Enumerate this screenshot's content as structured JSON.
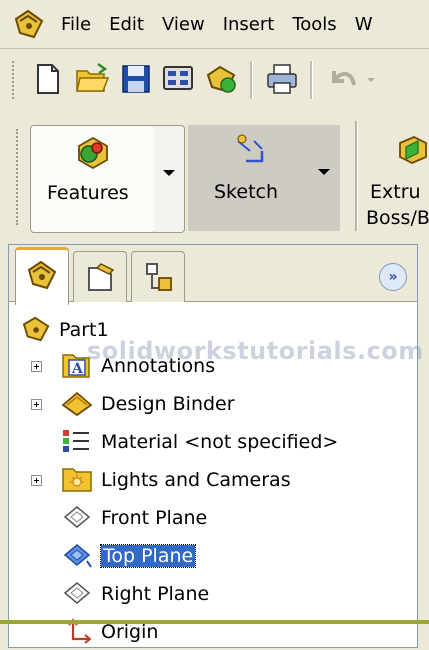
{
  "menu": {
    "items": [
      {
        "label": "File"
      },
      {
        "label": "Edit"
      },
      {
        "label": "View"
      },
      {
        "label": "Insert"
      },
      {
        "label": "Tools"
      },
      {
        "label": "W"
      }
    ]
  },
  "toolbar": {
    "buttons": [
      "new-document-icon",
      "open-folder-icon",
      "save-icon",
      "options-icon",
      "rebuild-icon",
      "print-icon",
      "undo-icon"
    ]
  },
  "command_manager": {
    "features_label": "Features",
    "sketch_label": "Sketch",
    "extrude_label_line1": "Extru",
    "extrude_label_line2": "Boss/B"
  },
  "feature_manager": {
    "root": "Part1",
    "watermark": "solidworkstutorials.com",
    "expand_glyph": "»",
    "items": [
      {
        "label": "Annotations",
        "expandable": true
      },
      {
        "label": "Design Binder",
        "expandable": true
      },
      {
        "label": "Material <not specified>",
        "expandable": false
      },
      {
        "label": "Lights and Cameras",
        "expandable": true
      },
      {
        "label": "Front Plane",
        "expandable": false
      },
      {
        "label": "Top Plane",
        "expandable": false,
        "selected": true
      },
      {
        "label": "Right Plane",
        "expandable": false
      },
      {
        "label": "Origin",
        "expandable": false
      }
    ]
  },
  "colors": {
    "chrome": "#ece9d8",
    "selection": "#316ac5",
    "accent_line": "#9aa832"
  }
}
